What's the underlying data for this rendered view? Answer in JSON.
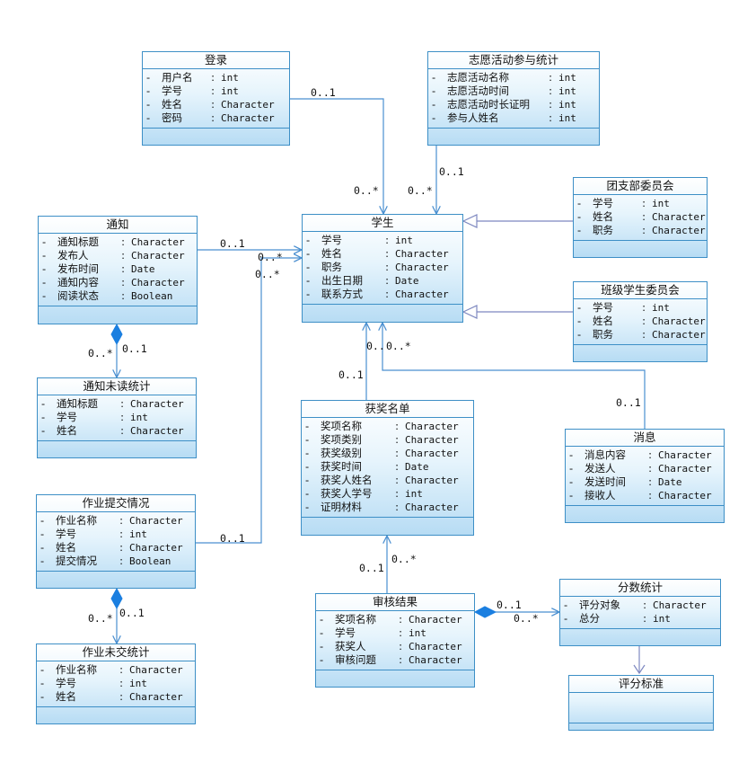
{
  "classes": {
    "login": {
      "name": "登录",
      "attributes": [
        {
          "vis": "-",
          "name": "用户名",
          "type": "int"
        },
        {
          "vis": "-",
          "name": "学号",
          "type": "int"
        },
        {
          "vis": "-",
          "name": "姓名",
          "type": "Character"
        },
        {
          "vis": "-",
          "name": "密码",
          "type": "Character"
        }
      ]
    },
    "volunteer": {
      "name": "志愿活动参与统计",
      "attributes": [
        {
          "vis": "-",
          "name": "志愿活动名称",
          "type": "int"
        },
        {
          "vis": "-",
          "name": "志愿活动时间",
          "type": "int"
        },
        {
          "vis": "-",
          "name": "志愿活动时长证明",
          "type": "int"
        },
        {
          "vis": "-",
          "name": "参与人姓名",
          "type": "int"
        }
      ]
    },
    "league": {
      "name": "团支部委员会",
      "attributes": [
        {
          "vis": "-",
          "name": "学号",
          "type": "int"
        },
        {
          "vis": "-",
          "name": "姓名",
          "type": "Character"
        },
        {
          "vis": "-",
          "name": "职务",
          "type": "Character"
        }
      ]
    },
    "notice": {
      "name": "通知",
      "attributes": [
        {
          "vis": "-",
          "name": "通知标题",
          "type": "Character"
        },
        {
          "vis": "-",
          "name": "发布人",
          "type": "Character"
        },
        {
          "vis": "-",
          "name": "发布时间",
          "type": "Date"
        },
        {
          "vis": "-",
          "name": "通知内容",
          "type": "Character"
        },
        {
          "vis": "-",
          "name": "阅读状态",
          "type": "Boolean"
        }
      ]
    },
    "student": {
      "name": "学生",
      "attributes": [
        {
          "vis": "-",
          "name": "学号",
          "type": "int"
        },
        {
          "vis": "-",
          "name": "姓名",
          "type": "Character"
        },
        {
          "vis": "-",
          "name": "职务",
          "type": "Character"
        },
        {
          "vis": "-",
          "name": "出生日期",
          "type": "Date"
        },
        {
          "vis": "-",
          "name": "联系方式",
          "type": "Character"
        }
      ]
    },
    "classcommittee": {
      "name": "班级学生委员会",
      "attributes": [
        {
          "vis": "-",
          "name": "学号",
          "type": "int"
        },
        {
          "vis": "-",
          "name": "姓名",
          "type": "Character"
        },
        {
          "vis": "-",
          "name": "职务",
          "type": "Character"
        }
      ]
    },
    "unread": {
      "name": "通知未读统计",
      "attributes": [
        {
          "vis": "-",
          "name": "通知标题",
          "type": "Character"
        },
        {
          "vis": "-",
          "name": "学号",
          "type": "int"
        },
        {
          "vis": "-",
          "name": "姓名",
          "type": "Character"
        }
      ]
    },
    "award": {
      "name": "获奖名单",
      "attributes": [
        {
          "vis": "-",
          "name": "奖项名称",
          "type": "Character"
        },
        {
          "vis": "-",
          "name": "奖项类别",
          "type": "Character"
        },
        {
          "vis": "-",
          "name": "获奖级别",
          "type": "Character"
        },
        {
          "vis": "-",
          "name": "获奖时间",
          "type": "Date"
        },
        {
          "vis": "-",
          "name": "获奖人姓名",
          "type": "Character"
        },
        {
          "vis": "-",
          "name": "获奖人学号",
          "type": "int"
        },
        {
          "vis": "-",
          "name": "证明材料",
          "type": "Character"
        }
      ]
    },
    "message": {
      "name": "消息",
      "attributes": [
        {
          "vis": "-",
          "name": "消息内容",
          "type": "Character"
        },
        {
          "vis": "-",
          "name": "发送人",
          "type": "Character"
        },
        {
          "vis": "-",
          "name": "发送时间",
          "type": "Date"
        },
        {
          "vis": "-",
          "name": "接收人",
          "type": "Character"
        }
      ]
    },
    "homework": {
      "name": "作业提交情况",
      "attributes": [
        {
          "vis": "-",
          "name": "作业名称",
          "type": "Character"
        },
        {
          "vis": "-",
          "name": "学号",
          "type": "int"
        },
        {
          "vis": "-",
          "name": "姓名",
          "type": "Character"
        },
        {
          "vis": "-",
          "name": "提交情况",
          "type": "Boolean"
        }
      ]
    },
    "review": {
      "name": "审核结果",
      "attributes": [
        {
          "vis": "-",
          "name": "奖项名称",
          "type": "Character"
        },
        {
          "vis": "-",
          "name": "学号",
          "type": "int"
        },
        {
          "vis": "-",
          "name": "获奖人",
          "type": "Character"
        },
        {
          "vis": "-",
          "name": "审核问题",
          "type": "Character"
        }
      ]
    },
    "score": {
      "name": "分数统计",
      "attributes": [
        {
          "vis": "-",
          "name": "评分对象",
          "type": "Character"
        },
        {
          "vis": "-",
          "name": "总分",
          "type": "int"
        }
      ]
    },
    "unsubmitted": {
      "name": "作业未交统计",
      "attributes": [
        {
          "vis": "-",
          "name": "作业名称",
          "type": "Character"
        },
        {
          "vis": "-",
          "name": "学号",
          "type": "int"
        },
        {
          "vis": "-",
          "name": "姓名",
          "type": "Character"
        }
      ]
    },
    "criteria": {
      "name": "评分标准",
      "attributes": []
    }
  },
  "multiplicities": {
    "login_src": "0..1",
    "login_dst": "0..*",
    "volunteer_src": "0..1",
    "volunteer_dst": "0..*",
    "notice_src": "0..1",
    "notice_dst": "0..*",
    "homework_dst": "0..*",
    "homework_src": "0..1",
    "unread_dst": "0..*",
    "unread_src": "0..1",
    "award_src": "0..1",
    "award_dst": "0..",
    "message_dst": "0..*",
    "message_src": "0..1",
    "review_award_dst": "0..*",
    "review_award_src": "0..1",
    "review_score_src": "0..1",
    "review_score_dst": "0..*",
    "unsubmitted_dst": "0..*",
    "unsubmitted_src": "0..1"
  },
  "colors": {
    "border": "#3d8fc6",
    "line": "#4a8fd0",
    "generalization": "#7e88c0",
    "composition": "#1b7fe0",
    "fill_top": "#ffffff",
    "fill_bottom": "#b7dcf4"
  }
}
